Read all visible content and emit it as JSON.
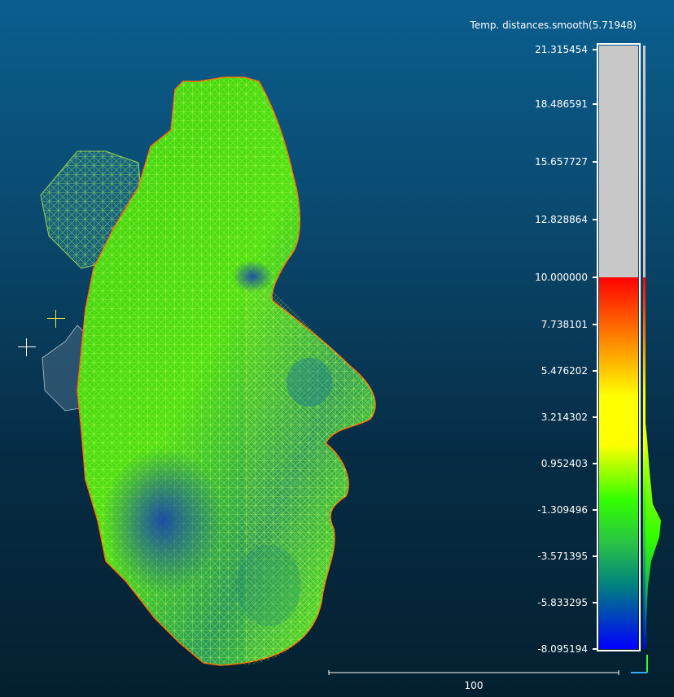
{
  "scalar_field": {
    "title": "Temp. distances.smooth(5.71948)",
    "ticks": [
      {
        "label": "21.315454",
        "value": 21.315454
      },
      {
        "label": "18.486591",
        "value": 18.486591
      },
      {
        "label": "15.657727",
        "value": 15.657727
      },
      {
        "label": "12.828864",
        "value": 12.828864
      },
      {
        "label": "10.000000",
        "value": 10.0
      },
      {
        "label": "7.738101",
        "value": 7.738101
      },
      {
        "label": "5.476202",
        "value": 5.476202
      },
      {
        "label": "3.214302",
        "value": 3.214302
      },
      {
        "label": "0.952403",
        "value": 0.952403
      },
      {
        "label": "-1.309496",
        "value": -1.309496
      },
      {
        "label": "-3.571395",
        "value": -3.571395
      },
      {
        "label": "-5.833295",
        "value": -5.833295
      },
      {
        "label": "-8.095194",
        "value": -8.095194
      }
    ],
    "colors": {
      "saturation_max": "#c8c8c8",
      "red": "#ff0000",
      "yellow": "#ffff00",
      "green": "#33ff00",
      "teal": "#008080",
      "blue": "#0000ff"
    }
  },
  "scale_bar": {
    "label": "100"
  },
  "mesh": {
    "icon": "face-mesh-3d"
  }
}
